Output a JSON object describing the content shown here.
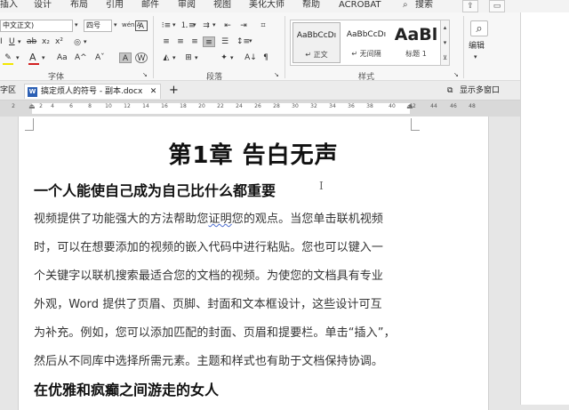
{
  "ribbon_tabs": [
    "插入",
    "设计",
    "布局",
    "引用",
    "邮件",
    "审阅",
    "视图",
    "美化大师",
    "帮助",
    "ACROBAT",
    "搜索"
  ],
  "font": {
    "name": "中文正文)",
    "size": "四号",
    "wen": "wén A",
    "bold": "B",
    "italic": "I",
    "underline": "U",
    "strike": "ab",
    "sub": "x₂",
    "sup": "x²",
    "grow": "A^",
    "shrink": "Aˇ",
    "aa": "Aa",
    "clear": "A",
    "char_border": "A",
    "word_art": "W",
    "highlight_color": "#f2e600",
    "font_color": "#d22020"
  },
  "groups": {
    "font": "字体",
    "paragraph": "段落",
    "styles": "样式",
    "editing": "编辑"
  },
  "styles": [
    {
      "sample": "AaBbCcDı",
      "name": "↵ 正文"
    },
    {
      "sample": "AaBbCcDı",
      "name": "↵ 无间隔"
    },
    {
      "sample": "AaBl",
      "name": "标题 1"
    }
  ],
  "doc_tabs": {
    "left_stub": "字区",
    "active": "搞定烦人的符号 - 副本.docx",
    "close": "✕",
    "new": "+",
    "multi_window": "显示多窗口"
  },
  "ruler": {
    "ticks": [
      "2",
      "2",
      "4",
      "6",
      "8",
      "10",
      "12",
      "14",
      "16",
      "18",
      "20",
      "22",
      "24",
      "26",
      "28",
      "30",
      "32",
      "34",
      "36",
      "38",
      "40",
      "42",
      "44",
      "46",
      "48"
    ]
  },
  "document": {
    "heading1": "第1章  告白无声",
    "heading2_a": "一个人能使自己成为自己比什么都重要",
    "para_lines": [
      "视频提供了功能强大的方法帮助您证明您的观点。当您单击联机视频",
      "时，可以在想要添加的视频的嵌入代码中进行粘贴。您也可以键入一",
      "个关键字以联机搜索最适合您的文档的视频。为使您的文档具有专业",
      "外观，Word 提供了页眉、页脚、封面和文本框设计，这些设计可互",
      "为补充。例如，您可以添加匹配的封面、页眉和提要栏。单击“插入”，",
      "然后从不同库中选择所需元素。主题和样式也有助于文档保持协调。"
    ],
    "squiggle_word": "证明",
    "heading2_b": "在优雅和疯癫之间游走的女人"
  }
}
